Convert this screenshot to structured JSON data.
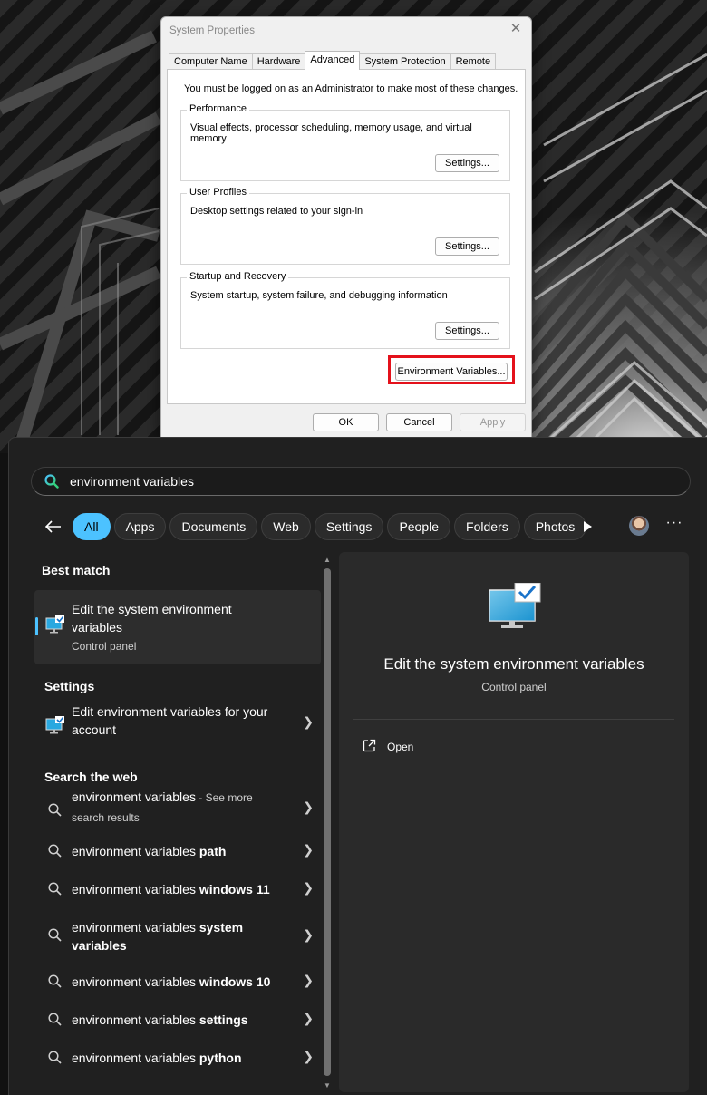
{
  "dialog": {
    "title": "System Properties",
    "close_glyph": "✕",
    "tabs": [
      {
        "label": "Computer Name"
      },
      {
        "label": "Hardware"
      },
      {
        "label": "Advanced"
      },
      {
        "label": "System Protection"
      },
      {
        "label": "Remote"
      }
    ],
    "active_tab": "Advanced",
    "admin_note": "You must be logged on as an Administrator to make most of these changes.",
    "groups": {
      "performance": {
        "legend": "Performance",
        "description": "Visual effects, processor scheduling, memory usage, and virtual memory",
        "button": "Settings..."
      },
      "user_profiles": {
        "legend": "User Profiles",
        "description": "Desktop settings related to your sign-in",
        "button": "Settings..."
      },
      "startup_recovery": {
        "legend": "Startup and Recovery",
        "description": "System startup, system failure, and debugging information",
        "button": "Settings..."
      }
    },
    "env_button": "Environment Variables...",
    "ok": "OK",
    "cancel": "Cancel",
    "apply": "Apply",
    "highlight_color": "#e4111b"
  },
  "search": {
    "query": "environment variables",
    "icon": "search-icon",
    "filters": [
      "All",
      "Apps",
      "Documents",
      "Web",
      "Settings",
      "People",
      "Folders",
      "Photos"
    ],
    "active_filter": "All",
    "accent": "#4cc2ff",
    "best_match_heading": "Best match",
    "best_match": {
      "title_line1": "Edit the system environment",
      "title_line2": "variables",
      "subtitle": "Control panel"
    },
    "settings_heading": "Settings",
    "settings_item": {
      "title_line1": "Edit environment variables for your",
      "title_line2": "account"
    },
    "web_heading": "Search the web",
    "web_items": [
      {
        "plain": "environment variables",
        "see_more": " - See more",
        "line2": "search results"
      },
      {
        "plain": "environment variables ",
        "bold": "path"
      },
      {
        "plain": "environment variables ",
        "bold": "windows 11"
      },
      {
        "plain": "environment variables ",
        "bold": "system",
        "bold2": "variables"
      },
      {
        "plain": "environment variables ",
        "bold": "windows 10"
      },
      {
        "plain": "environment variables ",
        "bold": "settings"
      },
      {
        "plain": "environment variables ",
        "bold": "python"
      }
    ],
    "detail": {
      "title": "Edit the system environment variables",
      "subtitle": "Control panel",
      "open_label": "Open"
    }
  }
}
